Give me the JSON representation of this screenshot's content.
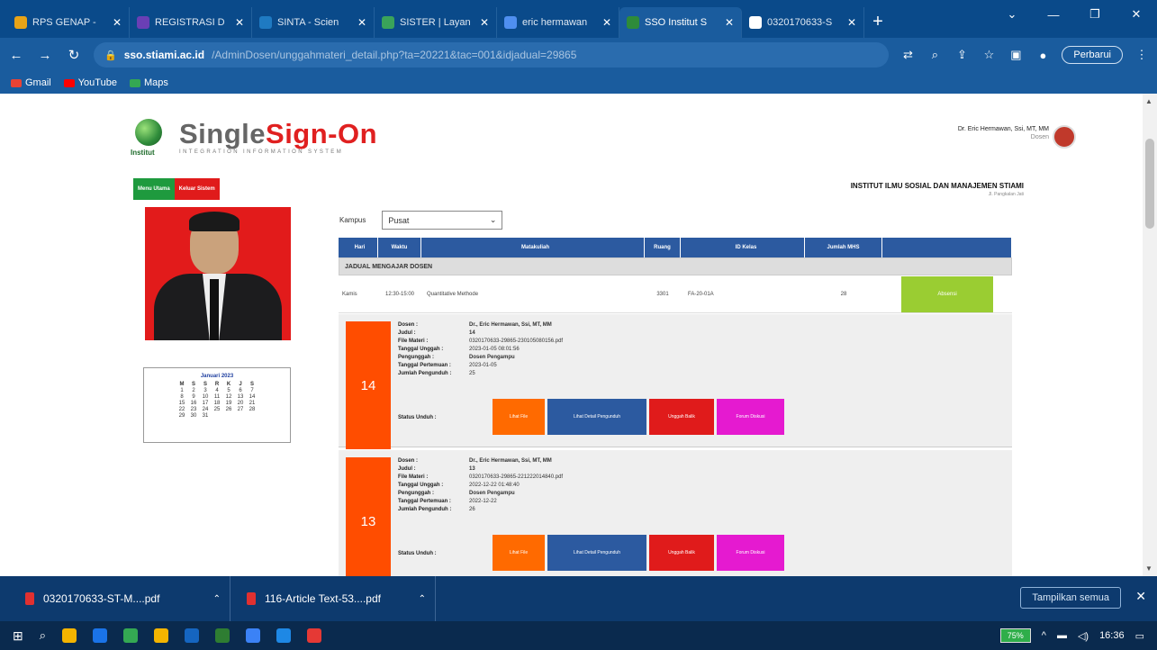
{
  "browser": {
    "tabs": [
      {
        "title": "RPS GENAP - ",
        "color": "#e8a317"
      },
      {
        "title": "REGISTRASI D",
        "color": "#6a3fb5"
      },
      {
        "title": "SINTA - Scien",
        "color": "#1f7ac2"
      },
      {
        "title": "SISTER | Layan",
        "color": "#3aa35a"
      },
      {
        "title": "eric hermawan",
        "color": "#4f8ff0"
      },
      {
        "title": "SSO Institut S",
        "color": "#2e8b3a"
      },
      {
        "title": "0320170633-S",
        "color": "#ffffff"
      }
    ],
    "url_host": "sso.stiami.ac.id",
    "url_path": "/AdminDosen/unggahmateri_detail.php?ta=20221&tac=001&idjadual=29865",
    "update_label": "Perbarui",
    "bookmarks": [
      {
        "label": "Gmail",
        "color": "#ea4335"
      },
      {
        "label": "YouTube",
        "color": "#ff0000"
      },
      {
        "label": "Maps",
        "color": "#34a853"
      }
    ]
  },
  "header": {
    "logo_caption": "Institut",
    "brand_single": "Single",
    "brand_signon": "Sign-On",
    "tagline": "INTEGRATION INFORMATION SYSTEM",
    "user_name": "Dr. Eric Hermawan, Ssi, MT, MM",
    "user_role": "Dosen",
    "institution": "INSTITUT ILMU SOSIAL DAN MANAJEMEN STIAMI",
    "institution_sub": "Jl. Pangkalan Jati",
    "menu_utama": "Menu Utama",
    "keluar": "Keluar Sistem"
  },
  "calendar": {
    "caption": "Januari 2023",
    "days": [
      "M",
      "S",
      "S",
      "R",
      "K",
      "J",
      "S"
    ],
    "weeks": [
      [
        "1",
        "2",
        "3",
        "4",
        "5",
        "6",
        "7"
      ],
      [
        "8",
        "9",
        "10",
        "11",
        "12",
        "13",
        "14"
      ],
      [
        "15",
        "16",
        "17",
        "18",
        "19",
        "20",
        "21"
      ],
      [
        "22",
        "23",
        "24",
        "25",
        "26",
        "27",
        "28"
      ],
      [
        "29",
        "30",
        "31",
        "",
        "",
        "",
        ""
      ]
    ]
  },
  "filter": {
    "label": "Kampus",
    "value": "Pusat"
  },
  "table": {
    "headers": [
      "Hari",
      "Waktu",
      "Matakuliah",
      "Ruang",
      "ID Kelas",
      "Jumlah MHS",
      ""
    ],
    "section": "JADUAL MENGAJAR DOSEN",
    "row": {
      "hari": "Kamis",
      "waktu": "12:30-15:00",
      "matakuliah": "Quantitative Methode",
      "ruang": "3301",
      "kelas": "FA-20-01A",
      "mhs": "28",
      "action": "Absensi"
    }
  },
  "card_labels": {
    "dosen": "Dosen :",
    "judul": "Judul :",
    "file": "File Materi :",
    "tgl_unggah": "Tanggal Unggah :",
    "pengunggah": "Pengunggah :",
    "tgl_pertemuan": "Tanggal Pertemuan :",
    "jml_pengunduh": "Jumlah Pengunduh :",
    "status": "Status Unduh :"
  },
  "card_buttons": {
    "lihat": "Lihat File",
    "detail": "Lihat Detail Pengunduh",
    "unggah": "Unggah Balik",
    "forum": "Forum Diskusi"
  },
  "cards": [
    {
      "num": "14",
      "dosen": "Dr., Eric Hermawan, Ssi, MT, MM",
      "judul": "14",
      "file": "0320170633-29865-230105080156.pdf",
      "tgl_unggah": "2023-01-05 08:01:56",
      "pengunggah": "Dosen Pengampu",
      "tgl_pertemuan": "2023-01-05",
      "jml_pengunduh": "25"
    },
    {
      "num": "13",
      "dosen": "Dr., Eric Hermawan, Ssi, MT, MM",
      "judul": "13",
      "file": "0320170633-29865-221222014840.pdf",
      "tgl_unggah": "2022-12-22 01:48:40",
      "pengunggah": "Dosen Pengampu",
      "tgl_pertemuan": "2022-12-22",
      "jml_pengunduh": "26"
    }
  ],
  "downloads": {
    "items": [
      "0320170633-ST-M....pdf",
      "116-Article Text-53....pdf"
    ],
    "show_all": "Tampilkan semua"
  },
  "taskbar": {
    "battery": "75%",
    "time": "16:36",
    "apps": [
      "#f4b400",
      "#1a73e8",
      "#34a853",
      "#f4b400",
      "#1565c0",
      "#2e7d32",
      "#3b82f6",
      "#1e88e5",
      "#e53935"
    ]
  }
}
